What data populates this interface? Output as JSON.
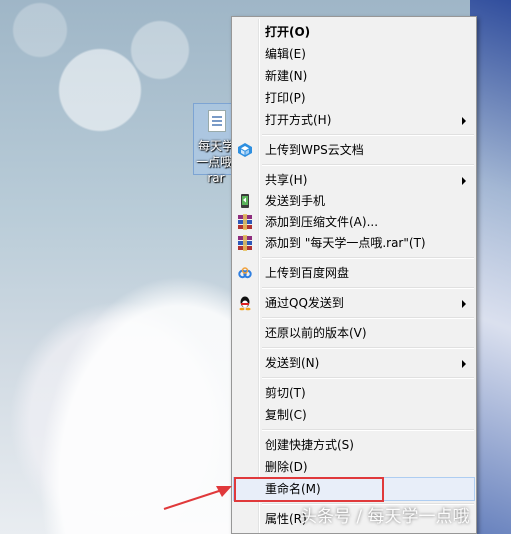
{
  "desktop_file": {
    "label": "每天学一点哦.rar",
    "visible_label": "每天学一点哦.rar"
  },
  "menu": {
    "items": [
      {
        "label": "打开(O)"
      },
      {
        "label": "编辑(E)"
      },
      {
        "label": "新建(N)"
      },
      {
        "label": "打印(P)"
      },
      {
        "label": "打开方式(H)"
      },
      {
        "label": "上传到WPS云文档"
      },
      {
        "label": "共享(H)"
      },
      {
        "label": "发送到手机"
      },
      {
        "label": "添加到压缩文件(A)..."
      },
      {
        "label": "添加到 \"每天学一点哦.rar\"(T)"
      },
      {
        "label": "上传到百度网盘"
      },
      {
        "label": "通过QQ发送到"
      },
      {
        "label": "还原以前的版本(V)"
      },
      {
        "label": "发送到(N)"
      },
      {
        "label": "剪切(T)"
      },
      {
        "label": "复制(C)"
      },
      {
        "label": "创建快捷方式(S)"
      },
      {
        "label": "删除(D)"
      },
      {
        "label": "重命名(M)"
      },
      {
        "label": "属性(R)"
      }
    ]
  },
  "watermark": "头条号 / 每天学一点哦",
  "colors": {
    "annotation_red": "#e0393b",
    "menu_bg": "#f1f1f1",
    "highlight": "#e8eef9"
  },
  "icons": [
    "wps-cloud-icon",
    "phone-send-icon",
    "winrar-icon",
    "baidu-netdisk-icon",
    "qq-penguin-icon"
  ]
}
